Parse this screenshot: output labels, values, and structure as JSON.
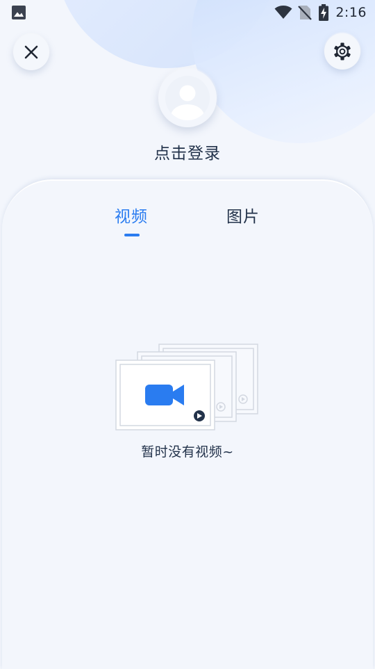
{
  "status_bar": {
    "time": "2:16",
    "left_icon": "image-icon",
    "right_icons": [
      "wifi-icon",
      "no-sim-icon",
      "battery-charging-icon"
    ]
  },
  "header": {
    "close_icon": "close-icon",
    "settings_icon": "gear-icon",
    "avatar_icon": "user-avatar-icon",
    "login_label": "点击登录"
  },
  "tabs": [
    {
      "label": "视频",
      "active": true
    },
    {
      "label": "图片",
      "active": false
    }
  ],
  "empty_state": {
    "illustration_icon": "video-camera-icon",
    "message": "暂时没有视频~"
  },
  "colors": {
    "accent": "#2a7cf0",
    "background": "#f3f6fc",
    "text": "#22324a"
  }
}
